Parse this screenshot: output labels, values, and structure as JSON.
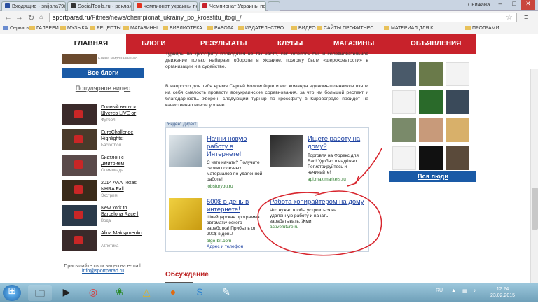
{
  "browser": {
    "tabs": [
      {
        "label": "Входящие - snijana79@r...",
        "color": "#2a4fa0"
      },
      {
        "label": "SocialTools.ru - реклама...",
        "color": "#333"
      },
      {
        "label": "чемпионат украины по к...",
        "color": "#e3321e"
      },
      {
        "label": "Чемпионат Украины по ...",
        "color": "#c8222b"
      }
    ],
    "user": "Снижана",
    "url_host": "sportparad.ru",
    "url_path": "/Fitnes/news/chempionat_ukrainy_po_krossfitu_itogi_/",
    "bookmarks": [
      "Сервисы",
      "ГАЛЕРЕИ",
      "МУЗЫКА",
      "РЕЦЕПТЫ",
      "МАГАЗИНЫ",
      "БИБЛИОТЕКА",
      "РАБОТА",
      "ИЗДАТЕЛЬСТВО",
      "ВИДЕО",
      "САЙТЫ ПРОФИТНЕС",
      "МАТЕРИАЛ ДЛЯ К...",
      "ПРОГРАМИ"
    ]
  },
  "nav": {
    "home": "ГЛАВНАЯ",
    "items": [
      "БЛОГИ",
      "РЕЗУЛЬТАТЫ",
      "КЛУБЫ",
      "МАГАЗИНЫ",
      "ОБЪЯВЛЕНИЯ"
    ]
  },
  "left": {
    "author": "Елена Мирошниченко",
    "all_blogs": "Все блоги",
    "popular": "Популярное видео",
    "videos": [
      {
        "title": "Полный выпуск Шустер LIVE от",
        "cat": "Футбол"
      },
      {
        "title": "EuroChallenge Highlights:",
        "cat": "Баскетбол"
      },
      {
        "title": "Биатлон с Дмитрием",
        "cat": "Олимпиада"
      },
      {
        "title": "2014 AAA Texas NHRA Fall",
        "cat": "Экстрим"
      },
      {
        "title": "New York to Barcelona Race |",
        "cat": "Вода"
      },
      {
        "title": "Alina Maksymenko",
        "cat": "Атлетика"
      }
    ],
    "contact_label": "Присылайте свои видео на e-mail:",
    "contact_email": "info@sportparad.ru"
  },
  "article": {
    "p1": "Турниры по кроссфиту проводятся не так часто, как хотелось бы, и соревновательное движение только набирает обороты в Украине, поэтому были «шероховатости» в организации и в судействе.",
    "p2": "В напросто для тебя время Сергей Коломойцев и его команда единомышленников взяли на себя смелость провести всеукраинские соревнования, за что им большой респект и благодарность. Уверен, следующий турнир по кроссфиту в Кировограде пройдет на качественно новом уровне."
  },
  "direct": {
    "label": "Яндекс.Директ",
    "ads": [
      {
        "title": "Начни новую работу в Интернете!",
        "desc": "С чего начать? Получите серию полезных материалов по удаленной работе!",
        "url": "jobsforyou.ru"
      },
      {
        "title": "Ищете работу на дому?",
        "desc": "Торговля на Форекс для Вас! Удобно и надёжно. Регистрируйтесь и начинайте!",
        "url": "api.maximarkets.ru"
      },
      {
        "title": "500$ в день в интернете!",
        "desc": "Швейцарская программа автоматического заработка! Прибыль от 200$ в день!",
        "url": "algo-bit.com",
        "extra": "Адрес и телефон"
      },
      {
        "title": "Работа копирайтером на дому",
        "desc": "Что нужно чтобы устроиться на удаленную работу и начать зарабатывать. Жми!",
        "url": "activefuture.ru"
      }
    ]
  },
  "discussion": "Обсуждение",
  "right": {
    "all_people": "Вся люди"
  },
  "taskbar": {
    "lang": "RU",
    "time": "12:24",
    "date": "23.02.2015"
  },
  "colors": {
    "brand_red": "#c8222b",
    "link_blue": "#1a5aa6",
    "annotation": "#d8262e"
  }
}
